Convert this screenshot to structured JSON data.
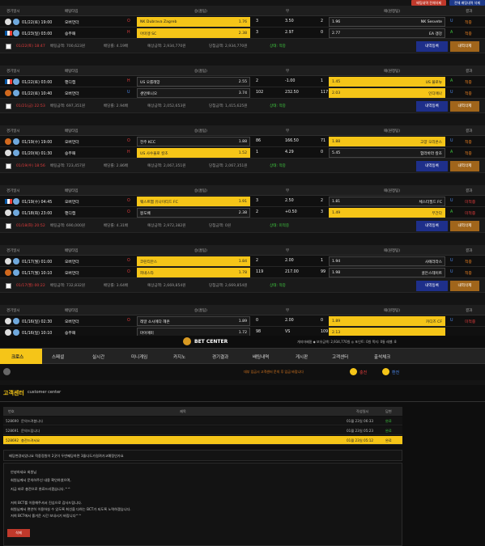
{
  "top_buttons": [
    "배팅내역 전체삭제",
    "전체 배팅내역 삭제"
  ],
  "headers": [
    "경기일시",
    "배팅타입",
    "승(홈팀)",
    "무",
    "패(원정팀)",
    "결과"
  ],
  "blocks": [
    {
      "rows": [
        {
          "icon": "ball",
          "date": "01/22(토) 19:00",
          "type": "오버언더",
          "pick": "O",
          "home": "NK Dubrava Zagreb",
          "hodds": "1.76",
          "hn": "3",
          "draw": "3.50",
          "an": "2",
          "aodds": "1.96",
          "away": "NK Sesvete",
          "ou": "U",
          "result": "적중",
          "sel": "home"
        },
        {
          "icon": "flag",
          "date": "01/23(일) 03:00",
          "type": "승무패",
          "pick": "H",
          "home": "아미엥 SC",
          "hodds": "2.38",
          "hn": "3",
          "draw": "2.97",
          "an": "0",
          "aodds": "2.77",
          "away": "EA 갱강",
          "ou": "A",
          "result": "적중",
          "sel": "home"
        }
      ],
      "sum": {
        "date": "01/22(토) 18:47",
        "bet": "배팅금액: 700,623원",
        "odds": "배당률: 4.19배",
        "expect": "예상금액: 2,934,770원",
        "win": "당첨금액: 2,934,770원",
        "status": "상태: 적중",
        "btn1": "내역등록",
        "btn2": "내역삭제"
      }
    },
    {
      "rows": [
        {
          "icon": "flag",
          "date": "01/22(토) 03:00",
          "type": "핸디캡",
          "pick": "H",
          "home": "US 오를레앙",
          "hodds": "2.55",
          "hn": "2",
          "draw": "-1.00",
          "an": "1",
          "aodds": "1.45",
          "away": "US 불로뉴",
          "ou": "A",
          "result": "적중",
          "sel": "away"
        },
        {
          "icon": "ball2",
          "date": "01/22(토) 10:40",
          "type": "오버언더",
          "pick": "U",
          "home": "샌안토니오",
          "hodds": "3.74",
          "hn": "102",
          "draw": "232.50",
          "an": "117",
          "aodds": "2.03",
          "away": "인디애나",
          "ou": "U",
          "result": "적중",
          "sel": "away"
        }
      ],
      "sum": {
        "date": "01/21(금) 22:53",
        "bet": "배팅금액: 697,351원",
        "odds": "배당률: 2.94배",
        "expect": "예상금액: 2,052,653원",
        "win": "당첨금액: 1,415,625원",
        "status": "상태: 적중",
        "btn1": "내역등록",
        "btn2": "내역삭제"
      }
    },
    {
      "rows": [
        {
          "icon": "ball2",
          "date": "01/19(수) 19:00",
          "type": "오버언더",
          "pick": "O",
          "home": "전주 KCC",
          "hodds": "1.88",
          "hn": "86",
          "draw": "166.50",
          "an": "71",
          "aodds": "1.88",
          "away": "고양 오리온스",
          "ou": "U",
          "result": "적중",
          "sel": "away"
        },
        {
          "icon": "ball",
          "date": "01/20(목) 01:30",
          "type": "승무패",
          "pick": "H",
          "home": "US 사수올로 칼초",
          "hodds": "1.52",
          "hn": "1",
          "draw": "4.29",
          "an": "0",
          "aodds": "5.45",
          "away": "함라바라 칼초",
          "ou": "A",
          "result": "적중",
          "sel": "home"
        }
      ],
      "sum": {
        "date": "01/19(수) 18:56",
        "bet": "배팅금액: 723,457원",
        "odds": "배당률: 2.86배",
        "expect": "예상금액: 2,067,351원",
        "win": "당첨금액: 2,067,351원",
        "status": "상태: 적중",
        "btn1": "내역등록",
        "btn2": "내역삭제"
      }
    },
    {
      "rows": [
        {
          "icon": "flag",
          "date": "01/19(수) 04:45",
          "type": "오버언더",
          "pick": "O",
          "home": "웨스트햄 유나이티드 FC",
          "hodds": "1.91",
          "hn": "3",
          "draw": "2.50",
          "an": "2",
          "aodds": "1.81",
          "away": "체스터필드 FC",
          "ou": "U",
          "result": "미적중",
          "sel": "home"
        },
        {
          "icon": "ball",
          "date": "01/18(화) 23:00",
          "type": "핸디캡",
          "pick": "O",
          "home": "몽도배",
          "hodds": "2.38",
          "hn": "2",
          "draw": "+0.50",
          "an": "3",
          "aodds": "1.49",
          "away": "무간다",
          "ou": "A",
          "result": "미적중",
          "sel": "away"
        }
      ],
      "sum": {
        "date": "01/18(화) 20:52",
        "bet": "배팅금액: 690,000원",
        "odds": "배당률: 4.31배",
        "expect": "예상금액: 2,972,382원",
        "win": "당첨금액: 0원",
        "status": "상태: 미적중",
        "btn1": "내역등록",
        "btn2": "내역삭제"
      }
    },
    {
      "rows": [
        {
          "icon": "ball",
          "date": "01/17(월) 01:00",
          "type": "오버언더",
          "pick": "O",
          "home": "코린티안스",
          "hodds": "1.84",
          "hn": "2",
          "draw": "2.00",
          "an": "1",
          "aodds": "1.94",
          "away": "사에라라스",
          "ou": "U",
          "result": "적중",
          "sel": "home"
        },
        {
          "icon": "ball2",
          "date": "01/17(월) 10:10",
          "type": "오버언더",
          "pick": "O",
          "home": "피네스타",
          "hodds": "1.78",
          "hn": "119",
          "draw": "217.00",
          "an": "99",
          "aodds": "1.98",
          "away": "골든스테이트",
          "ou": "U",
          "result": "적중",
          "sel": "home"
        }
      ],
      "sum": {
        "date": "01/17(월) 00:22",
        "bet": "배팅금액: 732,832원",
        "odds": "배당률: 3.64배",
        "expect": "예상금액: 2,669,854원",
        "win": "당첨금액: 2,669,854원",
        "status": "상태: 적중",
        "btn1": "내역등록",
        "btn2": "내역삭제"
      }
    },
    {
      "rows": [
        {
          "icon": "ball",
          "date": "01/16(일) 02:30",
          "type": "오버언더",
          "pick": "O",
          "home": "레알 소시에다 헤온",
          "hodds": "1.89",
          "hn": "0",
          "draw": "2.00",
          "an": "0",
          "aodds": "1.89",
          "away": "카디즈 CF",
          "ou": "U",
          "result": "미적중",
          "sel": "away"
        },
        {
          "icon": "ball",
          "date": "01/16(일) 10:10",
          "type": "승무패",
          "pick": "",
          "home": "마이애미",
          "hodds": "1.72",
          "hn": "98",
          "draw": "VS",
          "an": "109",
          "aodds": "2.13",
          "away": "",
          "ou": "",
          "result": "",
          "sel": "away"
        }
      ]
    }
  ],
  "betcenter": {
    "title": "BET CENTER",
    "stats": "개지마혜밑   ◆ 보유금액: 2,934,770원   ◎ 포인트: 0원   쪽지: 0통   레벨: 8"
  },
  "nav": [
    "크로스",
    "스페셜",
    "실시간",
    "미니게임",
    "카지노",
    "경기결과",
    "배팅내역",
    "게시판",
    "고객센터",
    "출석체크"
  ],
  "notice": {
    "text": "대부 입금시 고객센터 문의 후 입금 바랍니다",
    "charge": "충전",
    "exchange": "환전"
  },
  "cc": {
    "title": "고객센터",
    "subtitle": "customer center",
    "cols": [
      "번호",
      "제목",
      "작성일시",
      "답변"
    ],
    "rows": [
      {
        "no": "528690",
        "title": "문의드려봅니다",
        "date": "01월 23일 06:33",
        "ans": "완료"
      },
      {
        "no": "528691",
        "title": "문의드립니다",
        "date": "01월 23일 05:23",
        "ans": "완료"
      },
      {
        "no": "528692",
        "title": "충전드려서요",
        "date": "01월 23일 05:12",
        "ans": "완료"
      }
    ],
    "question": "배당변경되었나요 적중정원이 2곳이 두번째당하면 3돌다도가걸려가고예정인가요",
    "answer": [
      "안녕하세요 회원님",
      "회원님께서 문의하주신 내용 확인하였으며,",
      "지금 바로 충전으로 완료드리겠습니다.^^",
      "",
      "저희 BCT를 이용해주셔서 진심으로 감사드립니다.",
      "회원님께서 편안히 이용하실 수 있도록 최선을 다하는 BCT가 되도록 노력하겠습니다.",
      "저희 BCT에서 즐거운 시간 보내시기 바랍니다^^"
    ],
    "delete": "삭제"
  }
}
